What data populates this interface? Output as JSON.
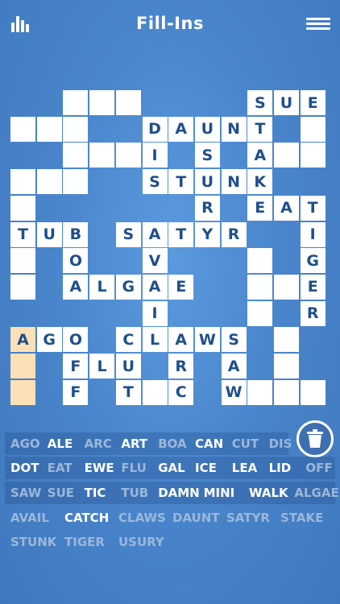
{
  "header": {
    "title": "Fill-Ins",
    "stats_icon": "bar-chart-icon",
    "menu_icon": "hamburger-menu-icon"
  },
  "colors": {
    "background": "#4a86cc",
    "cell": "#ffffff",
    "letter": "#1f4f8c",
    "highlight": "#fde0b6",
    "word_active": "#ffffff",
    "word_used": "#9bb7db"
  },
  "grid": {
    "cells": [
      {
        "c": 2,
        "r": 0,
        "l": ""
      },
      {
        "c": 3,
        "r": 0,
        "l": ""
      },
      {
        "c": 4,
        "r": 0,
        "l": ""
      },
      {
        "c": 9,
        "r": 0,
        "l": "S"
      },
      {
        "c": 10,
        "r": 0,
        "l": "U"
      },
      {
        "c": 11,
        "r": 0,
        "l": "E"
      },
      {
        "c": 0,
        "r": 1,
        "l": ""
      },
      {
        "c": 1,
        "r": 1,
        "l": ""
      },
      {
        "c": 2,
        "r": 1,
        "l": ""
      },
      {
        "c": 5,
        "r": 1,
        "l": "D"
      },
      {
        "c": 6,
        "r": 1,
        "l": "A"
      },
      {
        "c": 7,
        "r": 1,
        "l": "U"
      },
      {
        "c": 8,
        "r": 1,
        "l": "N"
      },
      {
        "c": 9,
        "r": 1,
        "l": "T"
      },
      {
        "c": 11,
        "r": 1,
        "l": ""
      },
      {
        "c": 2,
        "r": 2,
        "l": ""
      },
      {
        "c": 3,
        "r": 2,
        "l": ""
      },
      {
        "c": 4,
        "r": 2,
        "l": ""
      },
      {
        "c": 5,
        "r": 2,
        "l": "I"
      },
      {
        "c": 7,
        "r": 2,
        "l": "S"
      },
      {
        "c": 9,
        "r": 2,
        "l": "A"
      },
      {
        "c": 10,
        "r": 2,
        "l": ""
      },
      {
        "c": 11,
        "r": 2,
        "l": ""
      },
      {
        "c": 0,
        "r": 3,
        "l": ""
      },
      {
        "c": 1,
        "r": 3,
        "l": ""
      },
      {
        "c": 2,
        "r": 3,
        "l": ""
      },
      {
        "c": 5,
        "r": 3,
        "l": "S"
      },
      {
        "c": 6,
        "r": 3,
        "l": "T"
      },
      {
        "c": 7,
        "r": 3,
        "l": "U"
      },
      {
        "c": 8,
        "r": 3,
        "l": "N"
      },
      {
        "c": 9,
        "r": 3,
        "l": "K"
      },
      {
        "c": 0,
        "r": 4,
        "l": ""
      },
      {
        "c": 7,
        "r": 4,
        "l": "R"
      },
      {
        "c": 9,
        "r": 4,
        "l": "E"
      },
      {
        "c": 10,
        "r": 4,
        "l": "A"
      },
      {
        "c": 11,
        "r": 4,
        "l": "T"
      },
      {
        "c": 0,
        "r": 5,
        "l": "T"
      },
      {
        "c": 1,
        "r": 5,
        "l": "U"
      },
      {
        "c": 2,
        "r": 5,
        "l": "B"
      },
      {
        "c": 4,
        "r": 5,
        "l": "S"
      },
      {
        "c": 5,
        "r": 5,
        "l": "A"
      },
      {
        "c": 6,
        "r": 5,
        "l": "T"
      },
      {
        "c": 7,
        "r": 5,
        "l": "Y"
      },
      {
        "c": 8,
        "r": 5,
        "l": "R"
      },
      {
        "c": 11,
        "r": 5,
        "l": "I"
      },
      {
        "c": 0,
        "r": 6,
        "l": ""
      },
      {
        "c": 2,
        "r": 6,
        "l": "O"
      },
      {
        "c": 5,
        "r": 6,
        "l": "V"
      },
      {
        "c": 9,
        "r": 6,
        "l": ""
      },
      {
        "c": 11,
        "r": 6,
        "l": "G"
      },
      {
        "c": 0,
        "r": 7,
        "l": ""
      },
      {
        "c": 2,
        "r": 7,
        "l": "A"
      },
      {
        "c": 3,
        "r": 7,
        "l": "L"
      },
      {
        "c": 4,
        "r": 7,
        "l": "G"
      },
      {
        "c": 5,
        "r": 7,
        "l": "A"
      },
      {
        "c": 6,
        "r": 7,
        "l": "E"
      },
      {
        "c": 9,
        "r": 7,
        "l": ""
      },
      {
        "c": 10,
        "r": 7,
        "l": ""
      },
      {
        "c": 11,
        "r": 7,
        "l": "E"
      },
      {
        "c": 5,
        "r": 8,
        "l": "I"
      },
      {
        "c": 9,
        "r": 8,
        "l": ""
      },
      {
        "c": 11,
        "r": 8,
        "l": "R"
      },
      {
        "c": 0,
        "r": 9,
        "l": "A",
        "h": true
      },
      {
        "c": 1,
        "r": 9,
        "l": "G"
      },
      {
        "c": 2,
        "r": 9,
        "l": "O"
      },
      {
        "c": 4,
        "r": 9,
        "l": "C"
      },
      {
        "c": 5,
        "r": 9,
        "l": "L"
      },
      {
        "c": 6,
        "r": 9,
        "l": "A"
      },
      {
        "c": 7,
        "r": 9,
        "l": "W"
      },
      {
        "c": 8,
        "r": 9,
        "l": "S"
      },
      {
        "c": 10,
        "r": 9,
        "l": ""
      },
      {
        "c": 0,
        "r": 10,
        "l": "",
        "h": true
      },
      {
        "c": 2,
        "r": 10,
        "l": "F"
      },
      {
        "c": 3,
        "r": 10,
        "l": "L"
      },
      {
        "c": 4,
        "r": 10,
        "l": "U"
      },
      {
        "c": 6,
        "r": 10,
        "l": "R"
      },
      {
        "c": 8,
        "r": 10,
        "l": "A"
      },
      {
        "c": 10,
        "r": 10,
        "l": ""
      },
      {
        "c": 0,
        "r": 11,
        "l": "",
        "h": true
      },
      {
        "c": 2,
        "r": 11,
        "l": "F"
      },
      {
        "c": 4,
        "r": 11,
        "l": "T"
      },
      {
        "c": 5,
        "r": 11,
        "l": ""
      },
      {
        "c": 6,
        "r": 11,
        "l": "C"
      },
      {
        "c": 8,
        "r": 11,
        "l": "W"
      },
      {
        "c": 9,
        "r": 11,
        "l": ""
      },
      {
        "c": 10,
        "r": 11,
        "l": ""
      },
      {
        "c": 11,
        "r": 11,
        "l": ""
      }
    ]
  },
  "trash_icon": "trash-can-icon",
  "word_bank": {
    "rows": [
      [
        {
          "t": "AGO",
          "u": true
        },
        {
          "t": "ALE",
          "u": false
        },
        {
          "t": "ARC",
          "u": true
        },
        {
          "t": "ART",
          "u": false
        },
        {
          "t": "BOA",
          "u": true
        },
        {
          "t": "CAN",
          "u": false
        },
        {
          "t": "CUT",
          "u": true
        },
        {
          "t": "DIS",
          "u": true
        }
      ],
      [
        {
          "t": "DOT",
          "u": false
        },
        {
          "t": "EAT",
          "u": true
        },
        {
          "t": "EWE",
          "u": false
        },
        {
          "t": "FLU",
          "u": true
        },
        {
          "t": "GAL",
          "u": false
        },
        {
          "t": "ICE",
          "u": false
        },
        {
          "t": "LEA",
          "u": false
        },
        {
          "t": "LID",
          "u": false
        },
        {
          "t": "OFF",
          "u": true
        }
      ],
      [
        {
          "t": "SAW",
          "u": true
        },
        {
          "t": "SUE",
          "u": true
        },
        {
          "t": "TIC",
          "u": false
        },
        {
          "t": "TUB",
          "u": true
        },
        {
          "t": "DAMN",
          "u": false
        },
        {
          "t": "MINI",
          "u": false
        },
        {
          "t": "WALK",
          "u": false
        },
        {
          "t": "ALGAE",
          "u": true
        }
      ],
      [
        {
          "t": "AVAIL",
          "u": true
        },
        {
          "t": "CATCH",
          "u": false
        },
        {
          "t": "CLAWS",
          "u": true
        },
        {
          "t": "DAUNT",
          "u": true
        },
        {
          "t": "SATYR",
          "u": true
        },
        {
          "t": "STAKE",
          "u": true
        }
      ],
      [
        {
          "t": "STUNK",
          "u": true
        },
        {
          "t": "TIGER",
          "u": true
        },
        {
          "t": "USURY",
          "u": true
        }
      ]
    ]
  }
}
